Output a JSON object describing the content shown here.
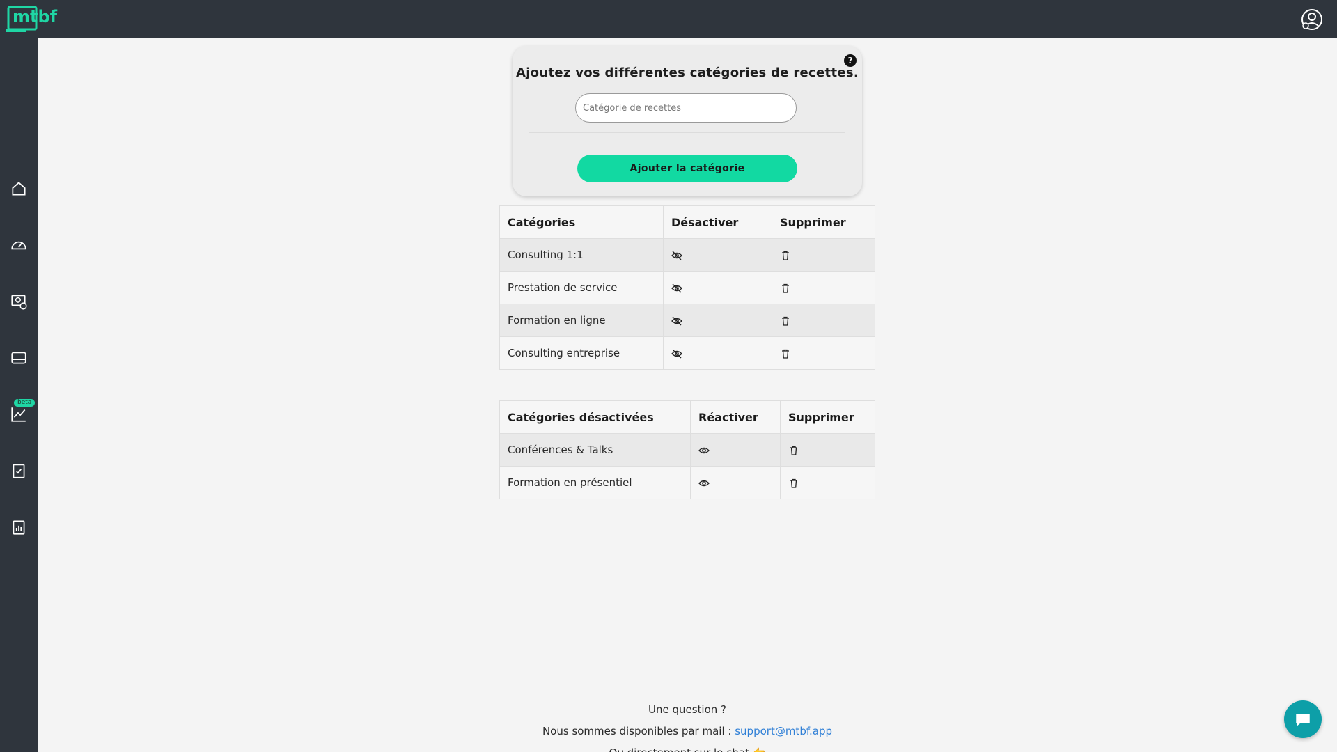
{
  "brand": {
    "logo_text": "mtbf",
    "accent_color": "#12d9a2",
    "topbar_color": "#2f353d"
  },
  "header": {
    "user_icon": "user-icon"
  },
  "sidebar": {
    "items": [
      {
        "id": "home",
        "icon": "home-icon"
      },
      {
        "id": "dashboard",
        "icon": "gauge-icon"
      },
      {
        "id": "payments",
        "icon": "money-screen-icon"
      },
      {
        "id": "cards",
        "icon": "card-icon"
      },
      {
        "id": "analytics",
        "icon": "chart-line-icon",
        "badge": "beta"
      },
      {
        "id": "tasks",
        "icon": "clipboard-check-icon"
      },
      {
        "id": "reports",
        "icon": "clipboard-chart-icon"
      }
    ]
  },
  "add_card": {
    "title": "Ajoutez vos différentes catégories de recettes.",
    "help": "?",
    "input_placeholder": "Catégorie de recettes",
    "input_value": "",
    "button_label": "Ajouter la catégorie"
  },
  "active_table": {
    "headers": [
      "Catégories",
      "Désactiver",
      "Supprimer"
    ],
    "rows": [
      {
        "name": "Consulting 1:1"
      },
      {
        "name": "Prestation de service"
      },
      {
        "name": "Formation en ligne"
      },
      {
        "name": "Consulting entreprise"
      }
    ]
  },
  "disabled_table": {
    "headers": [
      "Catégories désactivées",
      "Réactiver",
      "Supprimer"
    ],
    "rows": [
      {
        "name": "Conférences & Talks"
      },
      {
        "name": "Formation en présentiel"
      }
    ]
  },
  "footer": {
    "question": "Une question ?",
    "mail_prefix": "Nous sommes disponibles par mail : ",
    "mail_link": "support@mtbf.app",
    "chat_line": "Ou directement sur le chat 👉"
  },
  "chat": {
    "icon": "chat-bubble-icon"
  }
}
